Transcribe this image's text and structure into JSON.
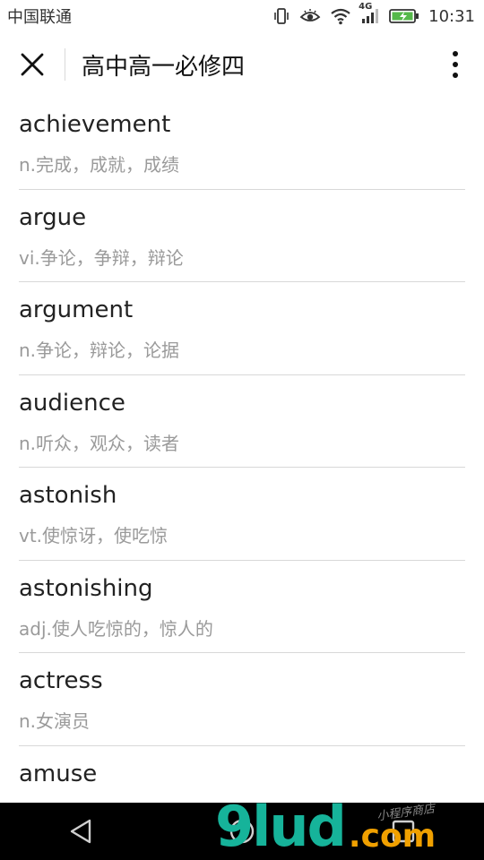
{
  "statusbar": {
    "carrier": "中国联通",
    "network": "4G",
    "time": "10:31",
    "icons": [
      "vibrate-icon",
      "eye-icon",
      "wifi-icon",
      "signal-icon",
      "battery-charging-icon"
    ]
  },
  "header": {
    "title": "高中高一必修四",
    "close_icon": "close-icon",
    "more_icon": "more-vertical-icon"
  },
  "words": [
    {
      "word": "achievement",
      "meaning": "n.完成，成就，成绩"
    },
    {
      "word": "argue",
      "meaning": "vi.争论，争辩，辩论"
    },
    {
      "word": "argument",
      "meaning": "n.争论，辩论，论据"
    },
    {
      "word": "audience",
      "meaning": "n.听众，观众，读者"
    },
    {
      "word": "astonish",
      "meaning": "vt.使惊讶，使吃惊"
    },
    {
      "word": "astonishing",
      "meaning": "adj.使人吃惊的，惊人的"
    },
    {
      "word": "actress",
      "meaning": "n.女演员"
    },
    {
      "word": "amuse",
      "meaning": ""
    }
  ],
  "navbar": {
    "buttons": [
      "back-icon",
      "home-icon",
      "recents-icon"
    ]
  },
  "watermark": {
    "main": "9lud",
    "suffix": ".com",
    "sub": "小程序商店"
  },
  "colors": {
    "accent_watermark": "#16b39a",
    "watermark_suffix": "#f0a000",
    "meaning_text": "#9a9a9a",
    "divider": "#d8d8d8"
  }
}
